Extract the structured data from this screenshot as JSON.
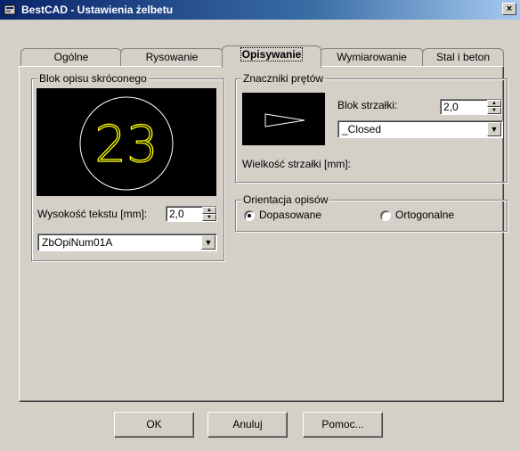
{
  "window": {
    "title": "BestCAD - Ustawienia żelbetu",
    "close_label": "×"
  },
  "tabs": [
    {
      "label": "Ogólne"
    },
    {
      "label": "Rysowanie"
    },
    {
      "label": "Opisywanie",
      "active": true
    },
    {
      "label": "Wymiarowanie"
    },
    {
      "label": "Stal i beton"
    }
  ],
  "short_label_block": {
    "title": "Blok opisu skróconego",
    "preview_number": "23",
    "preview_color": "#ffff00",
    "text_height_label": "Wysokość tekstu [mm]:",
    "text_height_value": "2,0",
    "block_name": "ZbOpiNum01A"
  },
  "bar_markers": {
    "title": "Znaczniki prętów",
    "arrow_block_label": "Blok strzałki:",
    "arrow_block_value": "2,0",
    "arrow_type": "_Closed",
    "arrow_size_label": "Wielkość strzałki [mm]:"
  },
  "orientation": {
    "title": "Orientacja opisów",
    "options": [
      {
        "label": "Dopasowane",
        "checked": true
      },
      {
        "label": "Ortogonalne",
        "checked": false
      }
    ]
  },
  "buttons": {
    "ok": "OK",
    "cancel": "Anuluj",
    "help": "Pomoc..."
  },
  "icons": [
    "app-icon",
    "close-icon",
    "dropdown-arrow-icon",
    "spin-up-icon",
    "spin-down-icon"
  ]
}
